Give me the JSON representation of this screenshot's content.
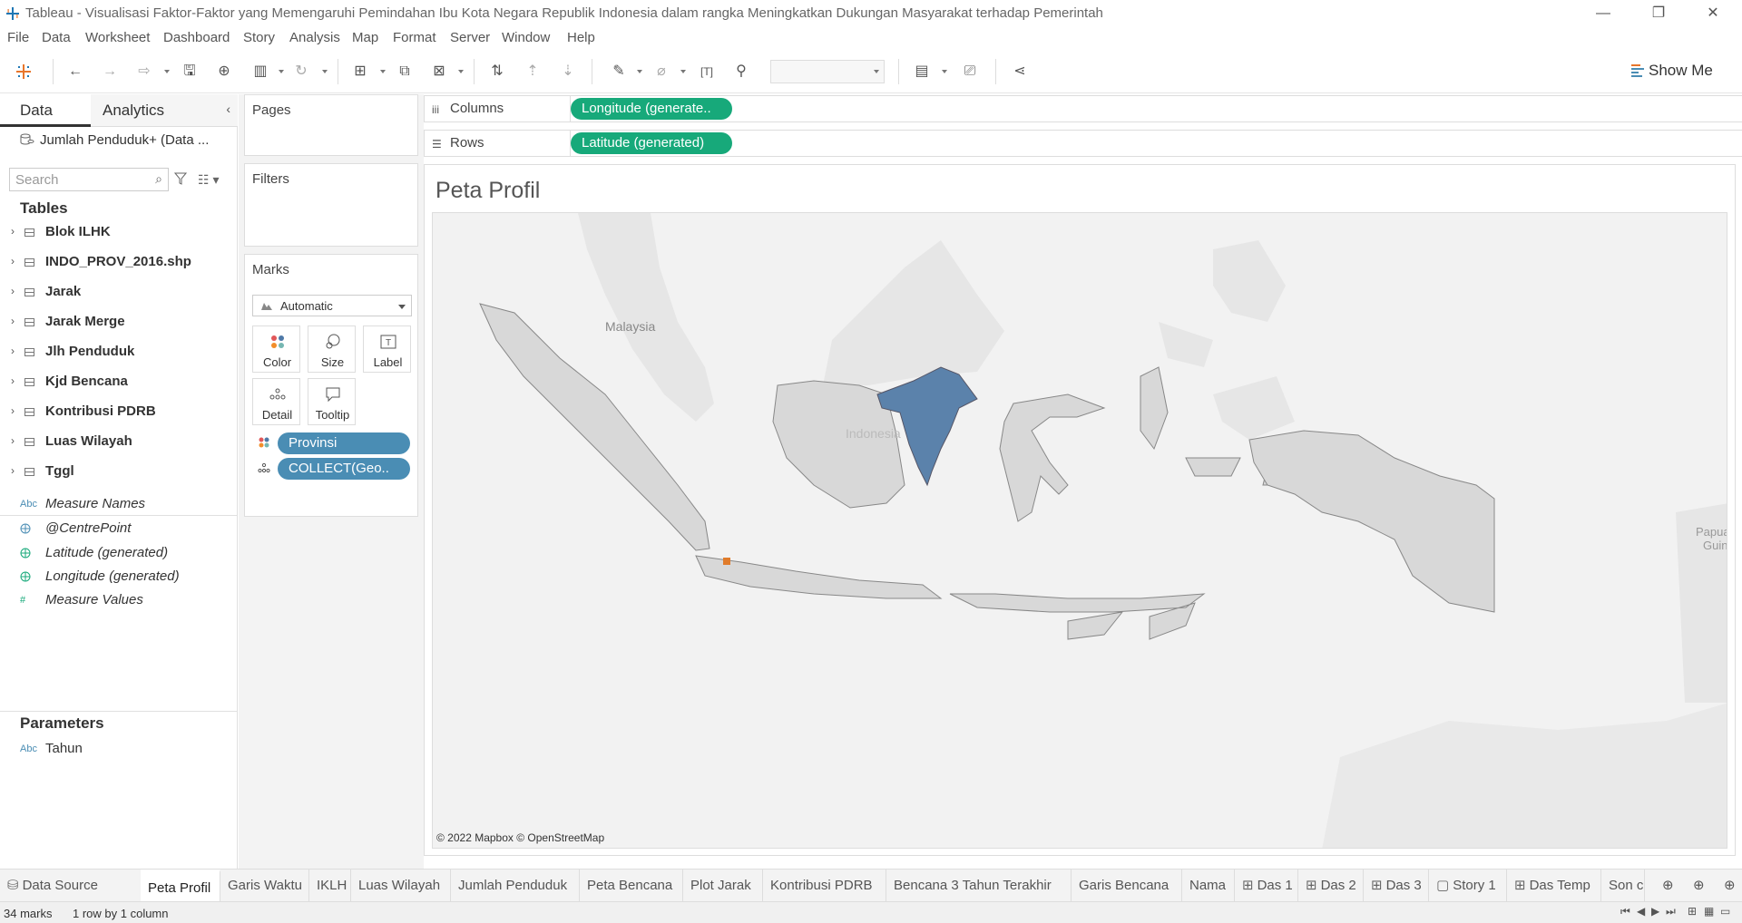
{
  "window": {
    "title": "Tableau - Visualisasi Faktor-Faktor yang Memengaruhi Pemindahan Ibu Kota Negara Republik Indonesia dalam rangka Meningkatkan Dukungan Masyarakat terhadap Pemerintah"
  },
  "menu": [
    "File",
    "Data",
    "Worksheet",
    "Dashboard",
    "Story",
    "Analysis",
    "Map",
    "Format",
    "Server",
    "Window",
    "Help"
  ],
  "toolbar": {
    "show_me_label": "Show Me"
  },
  "datapane": {
    "tabs": {
      "data": "Data",
      "analytics": "Analytics"
    },
    "datasource": "Jumlah Penduduk+ (Data ...",
    "search_placeholder": "Search",
    "tables_header": "Tables",
    "tables": [
      "Blok ILHK",
      "INDO_PROV_2016.shp",
      "Jarak",
      "Jarak Merge",
      "Jlh Penduduk",
      "Kjd Bencana",
      "Kontribusi PDRB",
      "Luas Wilayah",
      "Tggl"
    ],
    "fields": [
      {
        "icon_text": "Abc",
        "label": "Measure Names"
      },
      {
        "icon_text": "",
        "label": "@CentrePoint"
      },
      {
        "icon_text": "",
        "label": "Latitude (generated)"
      },
      {
        "icon_text": "",
        "label": "Longitude (generated)"
      },
      {
        "icon_text": "#",
        "label": "Measure Values"
      }
    ],
    "parameters_header": "Parameters",
    "parameters": [
      {
        "icon_text": "Abc",
        "label": "Tahun"
      }
    ]
  },
  "cards": {
    "pages": "Pages",
    "filters": "Filters",
    "marks": "Marks",
    "mark_type": "Automatic",
    "mark_buttons": [
      "Color",
      "Size",
      "Label",
      "Detail",
      "Tooltip"
    ],
    "mark_pills": [
      "Provinsi",
      "COLLECT(Geo.."
    ]
  },
  "shelves": {
    "columns_label": "Columns",
    "columns_pill": "Longitude (generate..",
    "rows_label": "Rows",
    "rows_pill": "Latitude (generated)"
  },
  "viz": {
    "title": "Peta Profil",
    "map_labels": {
      "malaysia": "Malaysia",
      "indonesia": "Indonesia",
      "png": "Papua N\nGuine"
    },
    "attribution": "© 2022 Mapbox © OpenStreetMap",
    "colors": {
      "land": "#d8d8d8",
      "highlight": "#5b82ab",
      "sea": "#f2f2f2",
      "neighbor": "#e6e6e6",
      "marker": "#e07b2a"
    }
  },
  "sheet_tabs": [
    {
      "label": "Data Source",
      "icon": "datasource-icon",
      "active": false
    },
    {
      "label": "Peta Profil",
      "icon": "",
      "active": true
    },
    {
      "label": "Garis Waktu",
      "icon": "",
      "active": false
    },
    {
      "label": "IKLH",
      "icon": "",
      "active": false
    },
    {
      "label": "Luas Wilayah",
      "icon": "",
      "active": false
    },
    {
      "label": "Jumlah Penduduk",
      "icon": "",
      "active": false
    },
    {
      "label": "Peta Bencana",
      "icon": "",
      "active": false
    },
    {
      "label": "Plot Jarak",
      "icon": "",
      "active": false
    },
    {
      "label": "Kontribusi PDRB",
      "icon": "",
      "active": false
    },
    {
      "label": "Bencana 3 Tahun Terakhir",
      "icon": "",
      "active": false
    },
    {
      "label": "Garis Bencana",
      "icon": "",
      "active": false
    },
    {
      "label": "Nama",
      "icon": "",
      "active": false
    },
    {
      "label": "Das 1",
      "icon": "dashboard-icon",
      "active": false
    },
    {
      "label": "Das 2",
      "icon": "dashboard-icon",
      "active": false
    },
    {
      "label": "Das 3",
      "icon": "dashboard-icon",
      "active": false
    },
    {
      "label": "Story 1",
      "icon": "story-icon",
      "active": false
    },
    {
      "label": "Das Temp",
      "icon": "dashboard-icon",
      "active": false
    },
    {
      "label": "Son c",
      "icon": "",
      "active": false
    }
  ],
  "status": {
    "marks": "34 marks",
    "dims": "1 row by 1 column"
  }
}
